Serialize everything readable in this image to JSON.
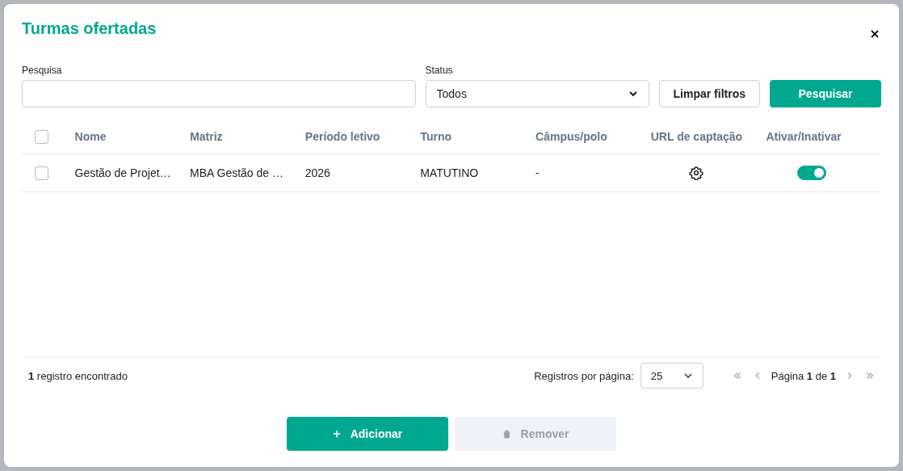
{
  "modal": {
    "title": "Turmas ofertadas"
  },
  "filters": {
    "search": {
      "label": "Pesquisa"
    },
    "status": {
      "label": "Status",
      "value": "Todos"
    },
    "clear_button": "Limpar filtros",
    "search_button": "Pesquisar"
  },
  "table": {
    "select_all": {
      "checked": false
    },
    "columns": [
      "Nome",
      "Matriz",
      "Período letivo",
      "Turno",
      "Câmpus/polo",
      "URL de captação",
      "Ativar/Inativar"
    ],
    "rows": [
      {
        "checked": false,
        "nome": "Gestão de Projet…",
        "matriz": "MBA Gestão de …",
        "periodo": "2026",
        "turno": "MATUTINO",
        "campus": "-",
        "active": true
      }
    ]
  },
  "footer": {
    "count": "**1** registro encontrado",
    "per_page_label": "Registros por página:",
    "per_page": "25",
    "page": "Página **1** de **1**",
    "pager": [
      {
        "kind": "first",
        "disabled": true
      },
      {
        "kind": "prev",
        "disabled": true
      },
      {
        "kind": "next",
        "disabled": true
      },
      {
        "kind": "last",
        "disabled": true
      }
    ]
  },
  "actions": [
    {
      "kind": "add",
      "label": "Adicionar",
      "disabled": false
    },
    {
      "kind": "remove",
      "label": "Remover",
      "disabled": true
    }
  ]
}
